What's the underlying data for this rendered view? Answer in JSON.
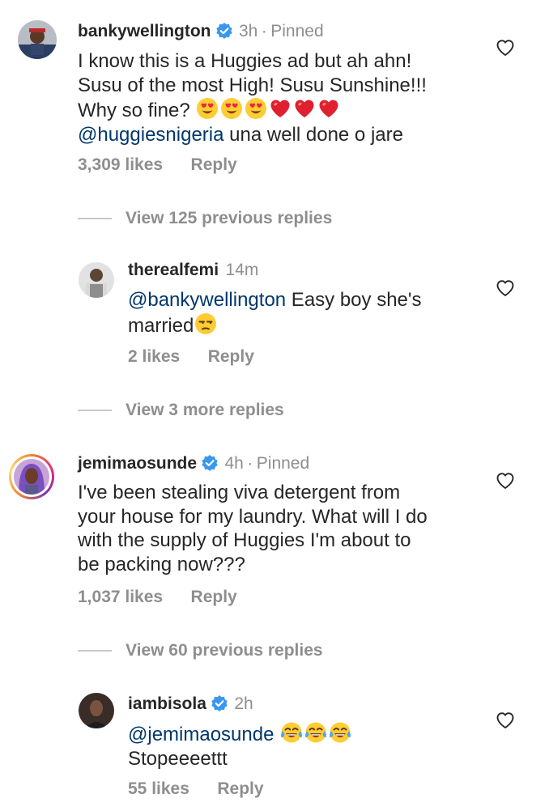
{
  "comments": [
    {
      "username": "bankywellington",
      "time": "3h",
      "pinned": "Pinned",
      "text_line1": "I know this is a Huggies ad but ah ahn!",
      "text_line2": "Susu of the most High! Susu Sunshine!!!",
      "text_line3": "Why so fine?",
      "mention": "@huggiesnigeria",
      "text_line4_rest": " una well done o jare",
      "likes": "3,309 likes",
      "reply": "Reply",
      "view_replies": "View 125 previous replies"
    },
    {
      "username": "jemimaosunde",
      "time": "4h",
      "pinned": "Pinned",
      "text_line1": "I've been stealing viva detergent from",
      "text_line2": "your house for my laundry. What will I do",
      "text_line3": "with the supply of Huggies I'm about to",
      "text_line4": "be packing now???",
      "likes": "1,037 likes",
      "reply": "Reply",
      "view_replies": "View 60 previous replies"
    }
  ],
  "replies": [
    {
      "username": "therealfemi",
      "time": "14m",
      "mention": "@bankywellington",
      "text_rest": " Easy boy she's",
      "text_line2": "married",
      "likes": "2 likes",
      "reply": "Reply",
      "view_more": "View 3 more replies"
    },
    {
      "username": "iambisola",
      "time": "2h",
      "mention": "@jemimaosunde",
      "text_line2": "Stopeeeettt",
      "likes": "55 likes",
      "reply": "Reply"
    }
  ],
  "icons": {
    "verified": "verified-badge-icon",
    "like": "heart-outline-icon",
    "emoji_heart_eyes": "heart-eyes-emoji",
    "emoji_red_heart": "red-heart-emoji",
    "emoji_unamused": "unamused-emoji",
    "emoji_joy": "tears-of-joy-emoji"
  },
  "colors": {
    "text": "#262626",
    "secondary": "#8e8e8e",
    "mention": "#00376b",
    "verified": "#3897f0",
    "story_ring_start": "#f58529",
    "story_ring_end": "#8134af"
  }
}
